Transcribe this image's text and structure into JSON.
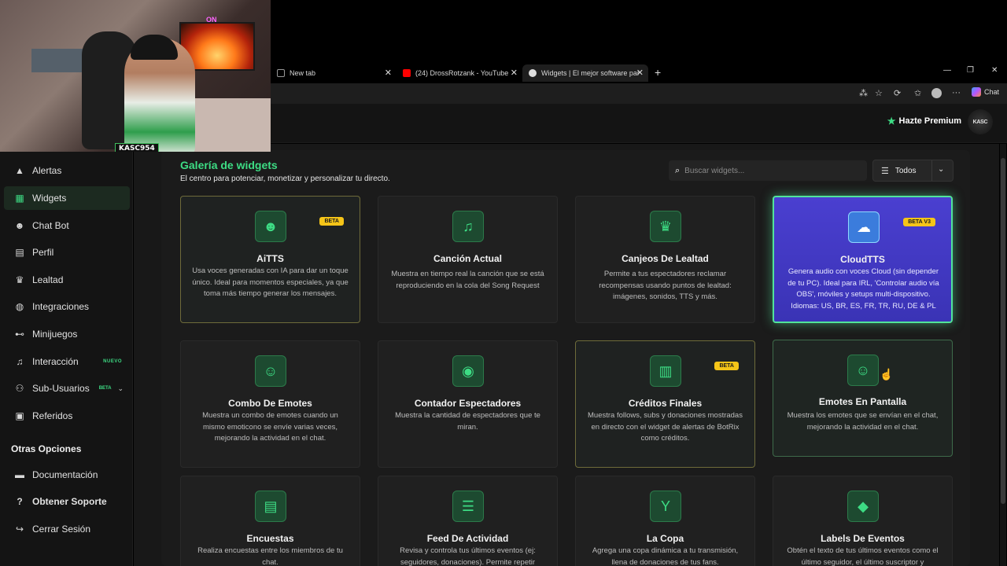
{
  "browser": {
    "tabs": [
      {
        "title": "New tab",
        "favicon_color": "#888888"
      },
      {
        "title": "(24) DrossRotzank - YouTube",
        "favicon_color": "#ff0000"
      },
      {
        "title": "Widgets | El mejor software para p",
        "favicon_color": "#dddddd"
      }
    ],
    "chat_label": "Chat"
  },
  "webcam": {
    "username_tag": "KASC954",
    "neon_sign": "ON"
  },
  "header": {
    "premium_label": "Hazte Premium",
    "logo_text": "KASC"
  },
  "sidebar": {
    "items": [
      {
        "label": "Alertas",
        "icon": "warning-icon"
      },
      {
        "label": "Widgets",
        "icon": "grid-icon"
      },
      {
        "label": "Chat Bot",
        "icon": "robot-icon"
      },
      {
        "label": "Perfil",
        "icon": "id-card-icon"
      },
      {
        "label": "Lealtad",
        "icon": "trophy-icon"
      },
      {
        "label": "Integraciones",
        "icon": "plug-icon"
      },
      {
        "label": "Minijuegos",
        "icon": "gamepad-icon"
      },
      {
        "label": "Interacción",
        "icon": "music-icon",
        "badge": "NUEVO"
      },
      {
        "label": "Sub-Usuarios",
        "icon": "users-icon",
        "badge": "BETA"
      },
      {
        "label": "Referidos",
        "icon": "contacts-icon"
      }
    ],
    "other_heading": "Otras Opciones",
    "other_items": [
      {
        "label": "Documentación",
        "icon": "book-icon"
      },
      {
        "label": "Obtener Soporte",
        "icon": "help-icon"
      },
      {
        "label": "Cerrar Sesión",
        "icon": "logout-icon"
      }
    ]
  },
  "main": {
    "title": "Galería de widgets",
    "subtitle": "El centro para potenciar, monetizar y personalizar tu directo.",
    "search_placeholder": "Buscar widgets...",
    "filter_label": "Todos"
  },
  "cards": [
    {
      "title": "AiTTS",
      "desc": "Usa voces generadas con IA para dar un toque único. Ideal para momentos especiales, ya que toma más tiempo generar los mensajes.",
      "badge": "BETA",
      "icon": "robot-icon"
    },
    {
      "title": "Canción Actual",
      "desc": "Muestra en tiempo real la canción que se está reproduciendo en la cola del Song Request",
      "badge": "",
      "icon": "music-icon"
    },
    {
      "title": "Canjeos De Lealtad",
      "desc": "Permite a tus espectadores reclamar recompensas usando puntos de lealtad: imágenes, sonidos, TTS y más.",
      "badge": "",
      "icon": "trophy-icon"
    },
    {
      "title": "CloudTTS",
      "desc": "Genera audio con voces Cloud (sin depender de tu PC). Ideal para IRL, 'Controlar audio vía OBS', móviles y setups multi-dispositivo. Idiomas: US, BR, ES, FR, TR, RU, DE & PL",
      "badge": "BETA V3",
      "icon": "cloud-icon"
    },
    {
      "title": "Combo De Emotes",
      "desc": "Muestra un combo de emotes cuando un mismo emoticono se envíe varias veces, mejorando la actividad en el chat.",
      "badge": "",
      "icon": "emote-icon"
    },
    {
      "title": "Contador Espectadores",
      "desc": "Muestra la cantidad de espectadores que te miran.",
      "badge": "",
      "icon": "eye-icon"
    },
    {
      "title": "Créditos Finales",
      "desc": "Muestra follows, subs y donaciones mostradas en directo con el widget de alertas de BotRix como créditos.",
      "badge": "BETA",
      "icon": "film-icon"
    },
    {
      "title": "Emotes En Pantalla",
      "desc": "Muestra los emotes que se envían en el chat, mejorando la actividad en el chat.",
      "badge": "",
      "icon": "tongue-emoji-icon"
    },
    {
      "title": "Encuestas",
      "desc": "Realiza encuestas entre los miembros de tu chat.",
      "badge": "",
      "icon": "poll-icon"
    },
    {
      "title": "Feed De Actividad",
      "desc": "Revisa y controla tus últimos eventos (ej: seguidores, donaciones). Permite repetir",
      "badge": "",
      "icon": "list-icon"
    },
    {
      "title": "La Copa",
      "desc": "Agrega una copa dinámica a tu transmisión, llena de donaciones de tus fans.",
      "badge": "",
      "icon": "cocktail-icon"
    },
    {
      "title": "Labels De Eventos",
      "desc": "Obtén el texto de tus últimos eventos como el último seguidor, el último suscriptor y",
      "badge": "",
      "icon": "tags-icon"
    }
  ]
}
